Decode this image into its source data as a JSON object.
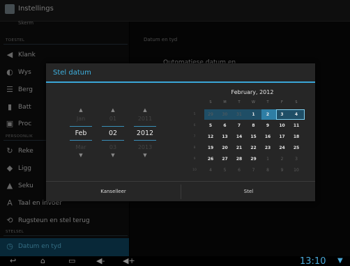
{
  "app": {
    "title": "Instellings"
  },
  "left_list": {
    "scroll_label": "Skerm",
    "section_device": "TOESTEL",
    "items_device": [
      {
        "label": "Klank",
        "icon": "speaker-icon"
      },
      {
        "label": "Wys",
        "icon": "brightness-icon"
      },
      {
        "label": "Berg",
        "icon": "storage-icon"
      },
      {
        "label": "Batt",
        "icon": "battery-icon"
      },
      {
        "label": "Proc",
        "icon": "apps-icon"
      }
    ],
    "section_personal": "PERSOONLIK",
    "items_personal": [
      {
        "label": "Reke",
        "icon": "sync-icon"
      },
      {
        "label": "Ligg",
        "icon": "location-icon"
      },
      {
        "label": "Seku",
        "icon": "lock-icon"
      },
      {
        "label": "Taal en invoer",
        "icon": "keyboard-icon"
      },
      {
        "label": "Rugsteun en stel terug",
        "icon": "backup-icon"
      }
    ],
    "section_system": "STELSEL",
    "selected": {
      "label": "Datum en tyd",
      "icon": "clock-icon"
    }
  },
  "right_pane": {
    "title": "Datum en tyd",
    "item": "Outomatiese datum en"
  },
  "dialog": {
    "title": "Stel datum",
    "spinners": [
      {
        "prev": "Jan",
        "current": "Feb",
        "next": "Mar"
      },
      {
        "prev": "01",
        "current": "02",
        "next": "03"
      },
      {
        "prev": "2011",
        "current": "2012",
        "next": "2013"
      }
    ],
    "calendar": {
      "month_label": "February, 2012",
      "weekdays": [
        "S",
        "M",
        "T",
        "W",
        "T",
        "F",
        "S"
      ],
      "week_numbers": [
        "5",
        "6",
        "7",
        "8",
        "9",
        "10"
      ],
      "weeks": [
        [
          "29",
          "30",
          "31",
          "1",
          "2",
          "3",
          "4"
        ],
        [
          "5",
          "6",
          "7",
          "8",
          "9",
          "10",
          "11"
        ],
        [
          "12",
          "13",
          "14",
          "15",
          "16",
          "17",
          "18"
        ],
        [
          "19",
          "20",
          "21",
          "22",
          "23",
          "24",
          "25"
        ],
        [
          "26",
          "27",
          "28",
          "29",
          "1",
          "2",
          "3"
        ],
        [
          "4",
          "5",
          "6",
          "7",
          "8",
          "9",
          "10"
        ]
      ],
      "selected_day": "2",
      "today": "3"
    },
    "cancel_label": "Kanselleer",
    "ok_label": "Stel"
  },
  "status": {
    "clock": "13:10"
  },
  "colors": {
    "accent": "#3aa6d8",
    "selected_row": "#0f4a66"
  }
}
